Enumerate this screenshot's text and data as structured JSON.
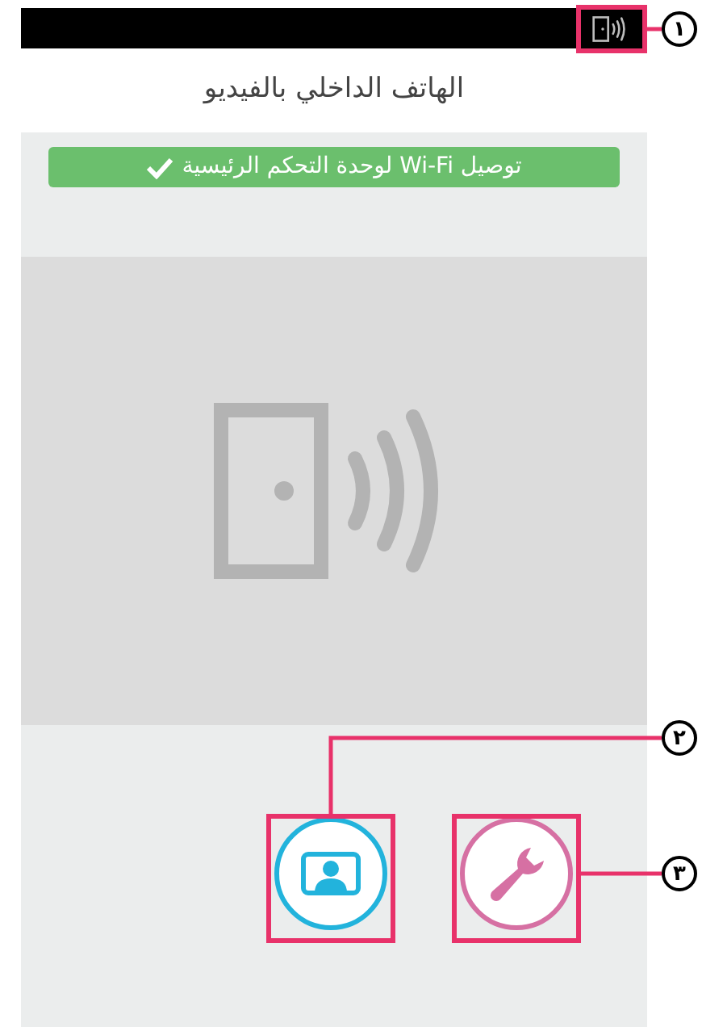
{
  "title": "الهاتف الداخلي بالفيديو",
  "banner": {
    "text": "توصيل Wi-Fi لوحدة التحكم الرئيسية"
  },
  "buttons": [
    {
      "kind": "video"
    },
    {
      "kind": "settings"
    }
  ],
  "callouts": [
    {
      "number": "١"
    },
    {
      "number": "٢"
    },
    {
      "number": "٣"
    }
  ]
}
